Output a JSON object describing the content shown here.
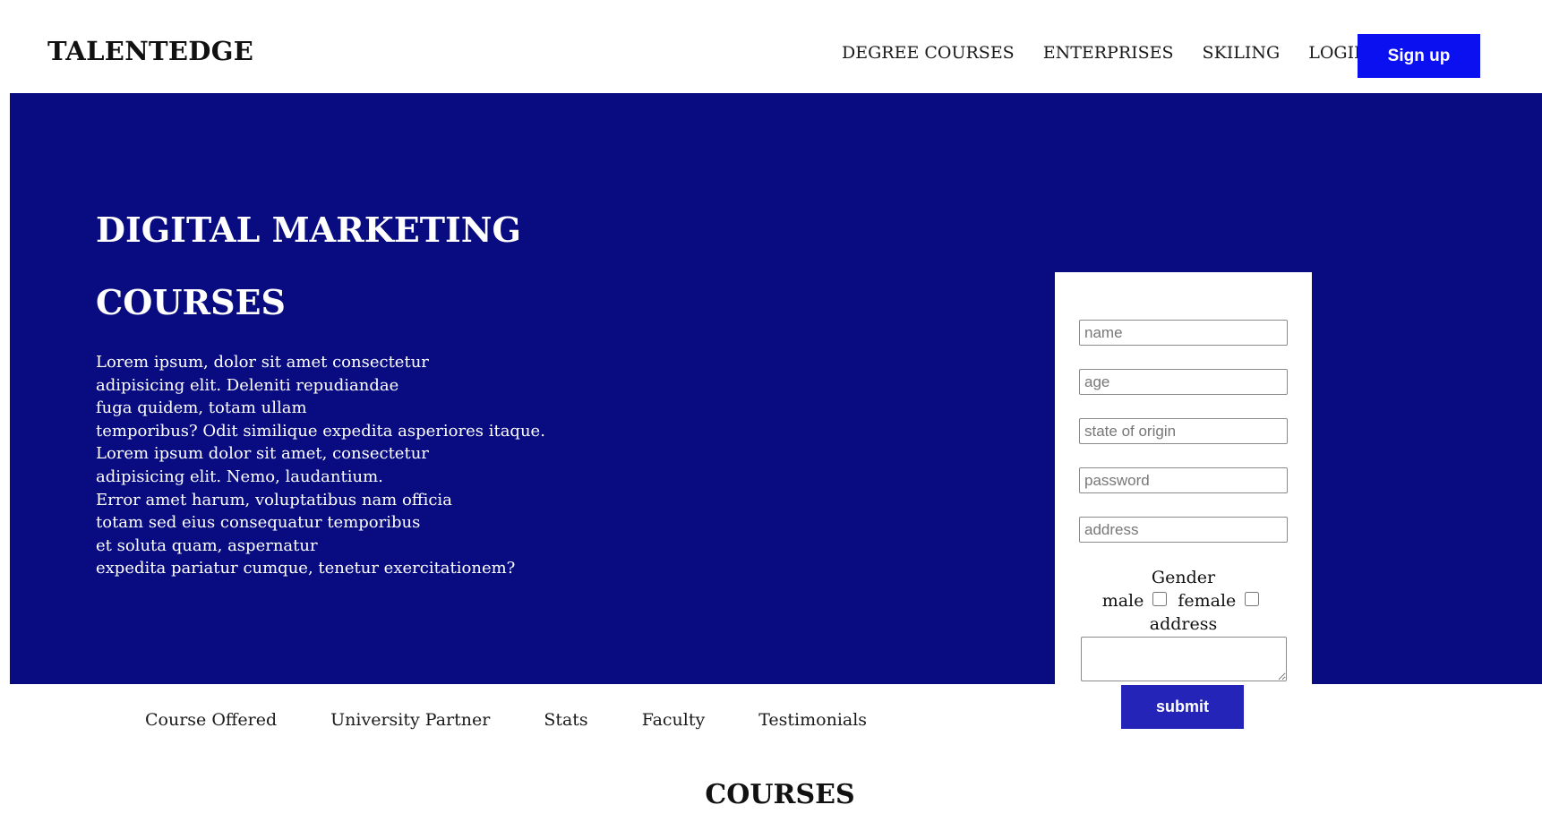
{
  "header": {
    "logo": "TALENTEDGE",
    "nav": [
      "DEGREE COURSES",
      "ENTERPRISES",
      "SKILING",
      "LOGIN"
    ],
    "signup_label": "Sign up"
  },
  "hero": {
    "title_lines": [
      "DIGITAL MARKETING",
      "COURSES"
    ],
    "body_lines": [
      "Lorem ipsum, dolor sit amet consectetur",
      "adipisicing elit. Deleniti repudiandae",
      "fuga quidem, totam ullam",
      "temporibus? Odit similique expedita asperiores itaque.",
      "Lorem ipsum dolor sit amet, consectetur",
      "adipisicing elit. Nemo, laudantium.",
      "Error amet harum, voluptatibus nam officia",
      "totam sed eius consequatur temporibus",
      "et soluta quam, aspernatur",
      "expedita pariatur cumque, tenetur exercitationem?"
    ]
  },
  "form": {
    "placeholders": [
      "name",
      "age",
      "state of origin",
      "password",
      "address"
    ],
    "gender_label": "Gender",
    "gender_options": [
      "male",
      "female"
    ],
    "address_label": "address",
    "submit_label": "submit"
  },
  "subnav": [
    "Course Offered",
    "University Partner",
    "Stats",
    "Faculty",
    "Testimonials"
  ],
  "section_title": "COURSES",
  "colors": {
    "hero_bg": "#080c80",
    "signup_bg": "#0a10f0",
    "submit_bg": "#2424b8"
  }
}
